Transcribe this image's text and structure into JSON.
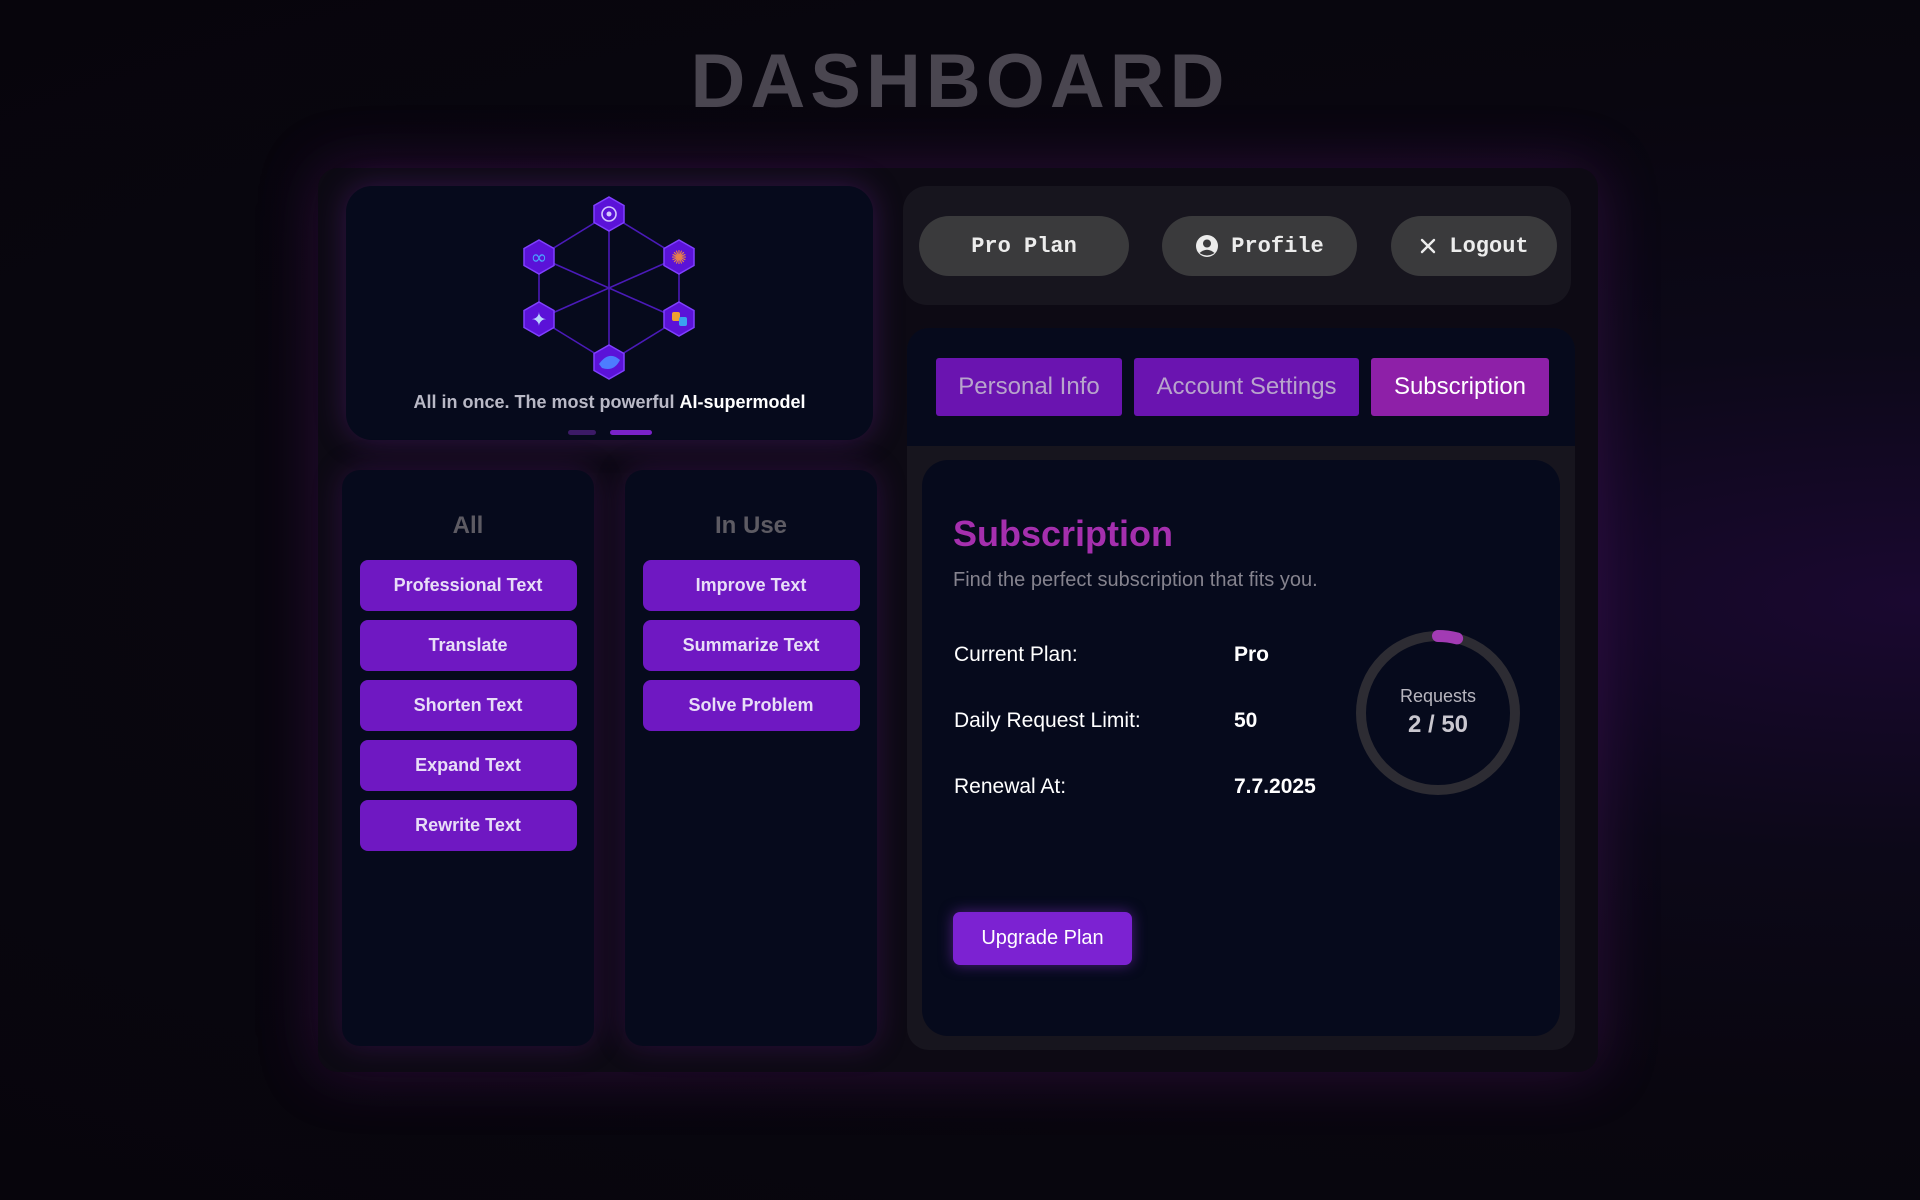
{
  "page": {
    "title": "DASHBOARD"
  },
  "carousel": {
    "tagline_prefix": "All in once. The most powerful",
    "tagline_highlight": "AI-supermodel",
    "slide_count": 2,
    "active_slide": 2,
    "model_icons": [
      "openai-icon",
      "meta-icon",
      "claude-icon",
      "gemini-icon",
      "copilot-icon",
      "deepseek-icon"
    ],
    "colors": {
      "hex_fill": "#5b12d8",
      "accent": "#7a22c8"
    }
  },
  "tools": {
    "all": {
      "title": "All",
      "items": [
        "Professional Text",
        "Translate",
        "Shorten Text",
        "Expand Text",
        "Rewrite Text"
      ]
    },
    "in_use": {
      "title": "In Use",
      "items": [
        "Improve Text",
        "Summarize Text",
        "Solve Problem"
      ]
    }
  },
  "header": {
    "plan_label": "Pro Plan",
    "profile_label": "Profile",
    "logout_label": "Logout"
  },
  "tabs": [
    {
      "label": "Personal Info",
      "active": false
    },
    {
      "label": "Account Settings",
      "active": false
    },
    {
      "label": "Subscription",
      "active": true
    }
  ],
  "subscription": {
    "title": "Subscription",
    "description": "Find the perfect subscription that fits you.",
    "rows": [
      {
        "label": "Current Plan:",
        "value": "Pro"
      },
      {
        "label": "Daily Request Limit:",
        "value": "50"
      },
      {
        "label": "Renewal At:",
        "value": "7.7.2025"
      }
    ],
    "requests": {
      "label": "Requests",
      "used": 2,
      "limit": 50,
      "display": "2 / 50"
    },
    "upgrade_label": "Upgrade Plan"
  },
  "colors": {
    "brand_purple": "#6f18c2",
    "active_tab": "#8e20a8",
    "subscription_title": "#a52fae",
    "progress": "#a23bb4"
  }
}
